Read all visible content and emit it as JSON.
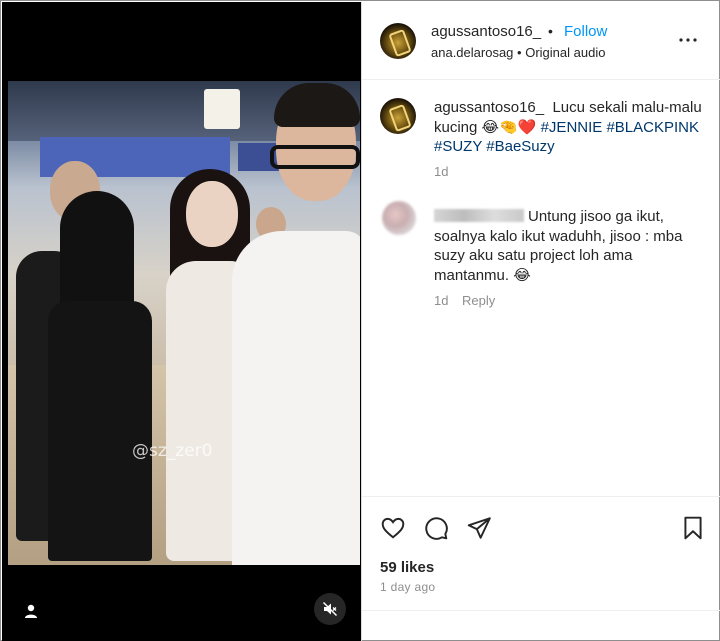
{
  "post": {
    "author": "agussantoso16_",
    "follow_label": "Follow",
    "separator": "•",
    "audio_owner": "ana.delarosag",
    "audio_sep": "•",
    "audio_label": "Original audio"
  },
  "media": {
    "watermark": "@sz_zer0"
  },
  "caption": {
    "username": "agussantoso16_",
    "text": "Lucu sekali malu-malu kucing 😂🤏❤️",
    "hashtags": [
      "#JENNIE",
      "#BLACKPINK",
      "#SUZY",
      "#BaeSuzy"
    ],
    "time": "1d"
  },
  "comment": {
    "text": "Untung jisoo ga ikut, soalnya kalo ikut waduhh, jisoo : mba suzy aku satu project loh ama mantanmu. 😂",
    "time": "1d",
    "reply_label": "Reply"
  },
  "stats": {
    "likes": "59 likes",
    "date": "1 day ago"
  },
  "colors": {
    "follow": "#0095f6",
    "hashtag": "#00376b",
    "muted": "#8e8e8e"
  },
  "icons": [
    "user-tag-icon",
    "mute-icon",
    "more-options-icon",
    "heart-icon",
    "comment-icon",
    "share-icon",
    "bookmark-icon"
  ]
}
